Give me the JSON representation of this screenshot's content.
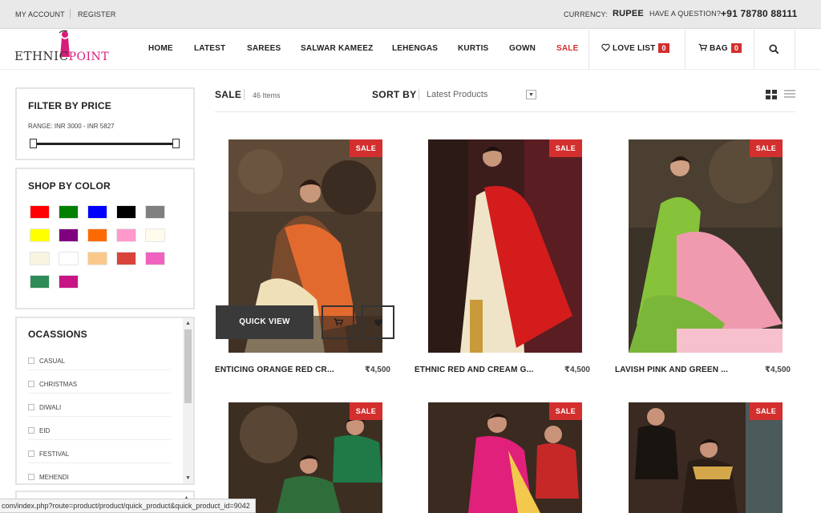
{
  "topbar": {
    "my_account": "MY ACCOUNT",
    "register": "REGISTER",
    "currency_label": "CURRENCY:",
    "currency_value": "RUPEE",
    "question_label": "HAVE A QUESTION?",
    "phone": "+91 78780 88111"
  },
  "logo": {
    "part1": "ETHNIC",
    "part2": "POINT"
  },
  "nav": {
    "home": "HOME",
    "latest": "LATEST",
    "sarees": "SAREES",
    "salwar": "SALWAR KAMEEZ",
    "lehengas": "LEHENGAS",
    "kurtis": "KURTIS",
    "gown": "GOWN",
    "sale": "SALE",
    "love_list": "LOVE LIST",
    "love_count": "0",
    "bag": "BAG",
    "bag_count": "0"
  },
  "filter_price": {
    "title": "FILTER BY PRICE",
    "range": "RANGE: INR 3000 - INR 5827"
  },
  "shop_color": {
    "title": "SHOP BY COLOR",
    "colors": [
      "#ff0000",
      "#008000",
      "#0000ff",
      "#000000",
      "#808080",
      "#ffff00",
      "#800080",
      "#ff6a00",
      "#ff99cc",
      "#fffbea",
      "#f8f4e0",
      "#ffffff",
      "#f9c98c",
      "#d9433a",
      "#f062c0",
      "#2e8b57",
      "#c71585"
    ]
  },
  "occasions": {
    "title": "OCASSIONS",
    "items": [
      "CASUAL",
      "CHRISTMAS",
      "DIWALI",
      "EID",
      "FESTIVAL",
      "MEHENDI"
    ]
  },
  "toolbar": {
    "title": "SALE",
    "count": "46 Items",
    "sort_label": "SORT BY",
    "sort_value": "Latest Products"
  },
  "products": [
    {
      "name": "ENTICING ORANGE RED CR...",
      "price": "₹4,500",
      "tag": "SALE"
    },
    {
      "name": "ETHNIC RED AND CREAM G...",
      "price": "₹4,500",
      "tag": "SALE"
    },
    {
      "name": "LAVISH PINK AND GREEN ...",
      "price": "₹4,500",
      "tag": "SALE"
    },
    {
      "tag": "SALE"
    },
    {
      "tag": "SALE"
    },
    {
      "tag": "SALE"
    }
  ],
  "quick_view": {
    "label": "QUICK VIEW"
  },
  "status_url": "com/index.php?route=product/product/quick_product&quick_product_id=9042"
}
